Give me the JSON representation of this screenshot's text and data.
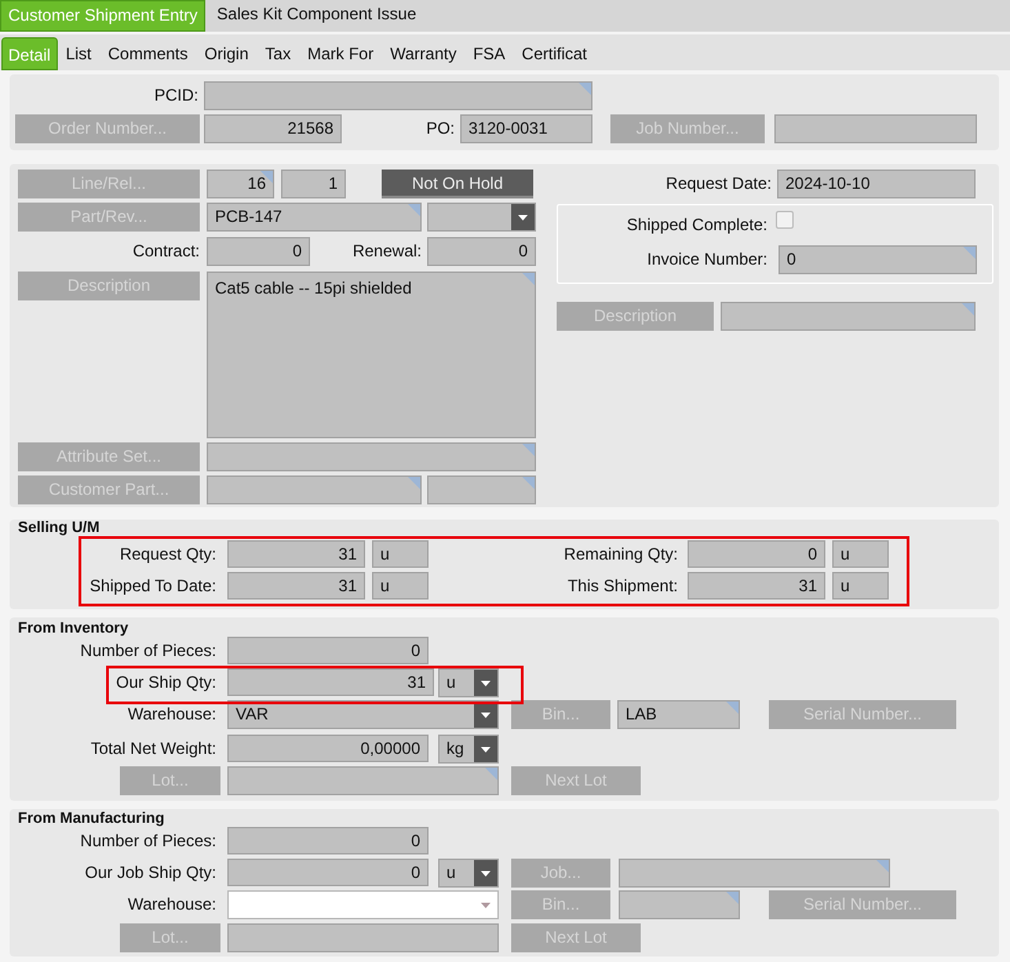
{
  "top_tabs": [
    {
      "label": "Customer Shipment Entry",
      "selected": true
    },
    {
      "label": "Sales Kit Component Issue",
      "selected": false
    }
  ],
  "detail_tabs": [
    {
      "label": "Detail",
      "selected": true
    },
    {
      "label": "List",
      "selected": false
    },
    {
      "label": "Comments",
      "selected": false
    },
    {
      "label": "Origin",
      "selected": false
    },
    {
      "label": "Tax",
      "selected": false
    },
    {
      "label": "Mark For",
      "selected": false
    },
    {
      "label": "Warranty",
      "selected": false
    },
    {
      "label": "FSA",
      "selected": false
    },
    {
      "label": "Certificat",
      "selected": false
    }
  ],
  "header": {
    "pcid_label": "PCID:",
    "order_button": {
      "label": "Order Number...",
      "disabled": true
    },
    "order_number": "21568",
    "po_label": "PO:",
    "po": "3120-0031",
    "job_button": {
      "label": "Job Number...",
      "disabled": true
    }
  },
  "line": {
    "line_button": {
      "label": "Line/Rel...",
      "disabled": true
    },
    "line": "16",
    "release": "1",
    "hold_status": "Not On Hold",
    "part_button": {
      "label": "Part/Rev...",
      "disabled": true
    },
    "part": "PCB-147",
    "contract_label": "Contract:",
    "contract": "0",
    "renewal_label": "Renewal:",
    "renewal": "0",
    "description_button": {
      "label": "Description",
      "disabled": true
    },
    "description": "Cat5 cable -- 15pi shielded",
    "attribute_button": {
      "label": "Attribute Set...",
      "disabled": true
    },
    "customer_part_button": {
      "label": "Customer Part...",
      "disabled": true
    },
    "request_date_label": "Request Date:",
    "request_date": "2024-10-10",
    "shipped_complete": {
      "label": "Shipped Complete:",
      "checked": false
    },
    "invoice_label": "Invoice Number:",
    "invoice": "0",
    "description2_button": {
      "label": "Description",
      "disabled": true
    }
  },
  "selling_um": {
    "title": "Selling U/M",
    "highlighted": true,
    "rows": [
      {
        "label": "Request Qty:",
        "value": "31",
        "unit": "u"
      },
      {
        "label": "Remaining Qty:",
        "value": "0",
        "unit": "u"
      },
      {
        "label": "Shipped To Date:",
        "value": "31",
        "unit": "u"
      },
      {
        "label": "This Shipment:",
        "value": "31",
        "unit": "u"
      }
    ]
  },
  "from_inventory": {
    "title": "From Inventory",
    "pieces_label": "Number of Pieces:",
    "pieces": "0",
    "ship_qty": {
      "label": "Our Ship Qty:",
      "value": "31",
      "unit": "u",
      "highlighted": true
    },
    "warehouse_label": "Warehouse:",
    "warehouse": {
      "value": "VAR",
      "editable": false
    },
    "bin_button": {
      "label": "Bin...",
      "disabled": true
    },
    "bin": "LAB",
    "serial_button": {
      "label": "Serial Number...",
      "disabled": true
    },
    "weight_label": "Total Net Weight:",
    "weight": "0,00000",
    "weight_unit": "kg",
    "lot_button": {
      "label": "Lot...",
      "disabled": true
    },
    "next_lot_button": {
      "label": "Next Lot",
      "disabled": true
    }
  },
  "from_manufacturing": {
    "title": "From Manufacturing",
    "pieces_label": "Number of Pieces:",
    "pieces": "0",
    "job_ship_qty": {
      "label": "Our Job Ship Qty:",
      "value": "0",
      "unit": "u"
    },
    "job_button": {
      "label": "Job...",
      "disabled": true
    },
    "warehouse_label": "Warehouse:",
    "warehouse": {
      "editable": true
    },
    "bin_button": {
      "label": "Bin...",
      "disabled": true
    },
    "serial_button": {
      "label": "Serial Number...",
      "disabled": true
    },
    "lot_button": {
      "label": "Lot...",
      "disabled": true
    },
    "next_lot_button": {
      "label": "Next Lot",
      "disabled": true
    }
  }
}
